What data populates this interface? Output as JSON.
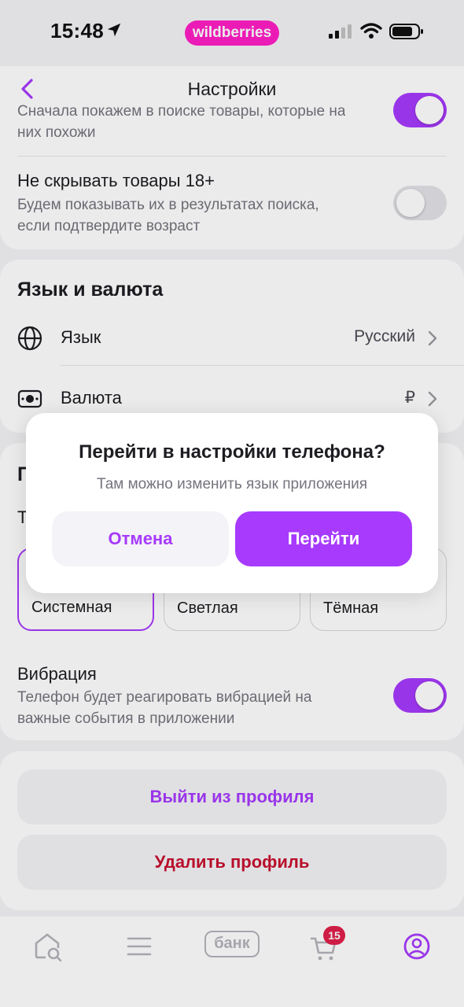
{
  "status_bar": {
    "time": "15:48",
    "brand": "wildberries"
  },
  "header": {
    "title": "Настройки"
  },
  "similar_items": {
    "subtitle_partial": "Сначала покажем в поиске товары, которые на",
    "subtitle_rest": "них похожи",
    "enabled": true
  },
  "adult_items": {
    "title": "Не скрывать товары 18+",
    "subtitle_line1": "Будем показывать их в результатах поиска,",
    "subtitle_line2": "если подтвердите возраст",
    "enabled": false
  },
  "language_currency": {
    "section_title": "Язык и валюта",
    "language": {
      "label": "Язык",
      "value": "Русский"
    },
    "currency": {
      "label": "Валюта",
      "value": "₽"
    }
  },
  "theme": {
    "section_initial": "П",
    "row_initial": "Т",
    "options": [
      "Системная",
      "Светлая",
      "Тёмная"
    ],
    "selected": "Системная"
  },
  "vibration": {
    "title": "Вибрация",
    "subtitle_line1": "Телефон будет реагировать вибрацией на",
    "subtitle_line2": "важные события в приложении",
    "enabled": true
  },
  "profile_actions": {
    "logout": "Выйти из профиля",
    "delete": "Удалить профиль"
  },
  "tabbar": {
    "bank_label": "банк",
    "cart_badge": "15"
  },
  "dialog": {
    "title": "Перейти в настройки телефона?",
    "message": "Там можно изменить язык приложения",
    "cancel": "Отмена",
    "confirm": "Перейти"
  },
  "colors": {
    "accent": "#a73afd",
    "brand_pink": "#ff1fc6",
    "danger": "#c8102e",
    "badge": "#e0204a"
  }
}
